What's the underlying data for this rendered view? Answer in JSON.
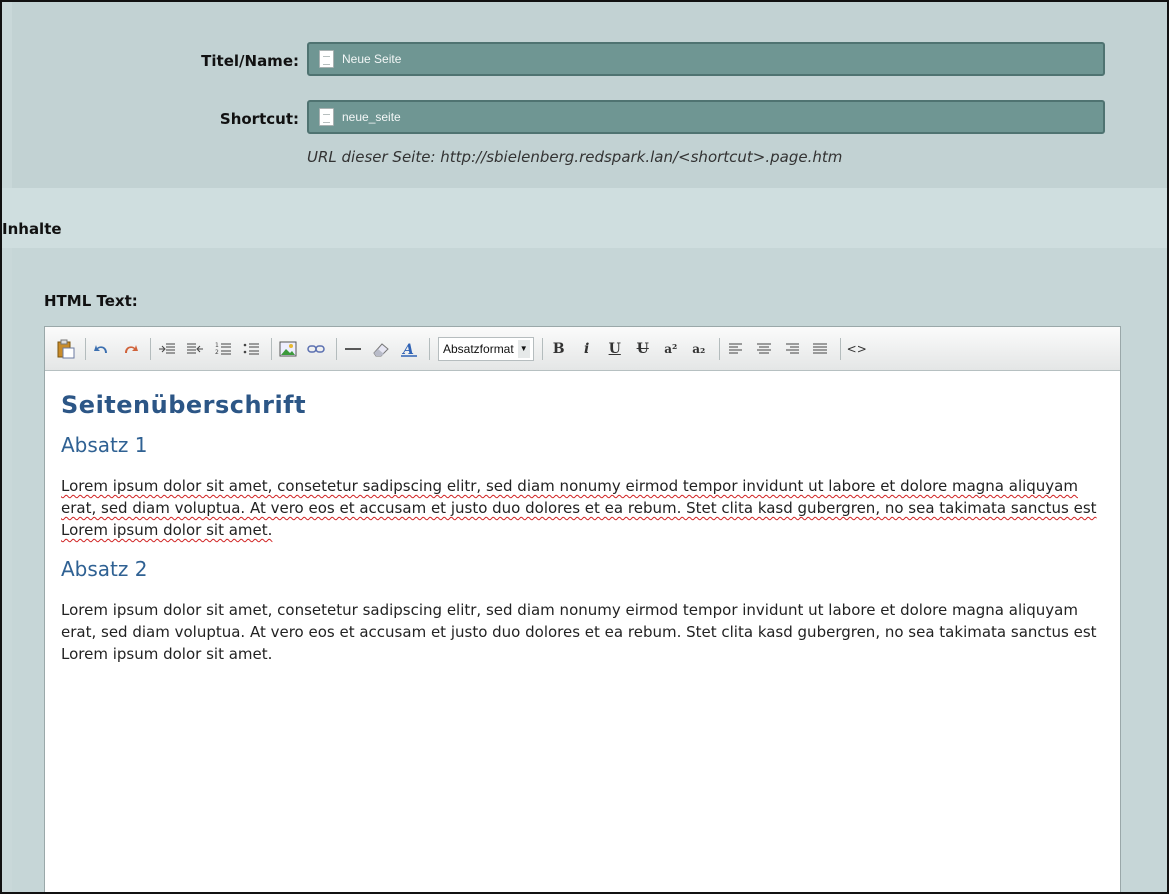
{
  "form": {
    "title_label": "Titel/Name:",
    "title_value": "Neue Seite",
    "shortcut_label": "Shortcut:",
    "shortcut_value": "neue_seite",
    "url_hint": "URL dieser Seite: http://sbielenberg.redspark.lan/<shortcut>.page.htm",
    "field_icon": "page-icon"
  },
  "section": {
    "title": "Inhalte"
  },
  "editor": {
    "label": "HTML Text:",
    "toolbar": {
      "format_select_value": "Absatzformat",
      "buttons": {
        "paste": "clipboard-icon",
        "undo": "undo-icon",
        "redo": "redo-icon",
        "indent": "indent-icon",
        "outdent": "outdent-icon",
        "ordered_list": "ordered-list-icon",
        "unordered_list": "unordered-list-icon",
        "image": "image-icon",
        "link": "link-icon",
        "horizontal_rule": "horizontal-rule-icon",
        "eraser": "eraser-icon",
        "text_style": "text-style-icon",
        "bold": "B",
        "italic": "i",
        "underline": "U",
        "strike": "U",
        "superscript": "a²",
        "subscript": "a₂",
        "align_left": "align-left-icon",
        "align_center": "align-center-icon",
        "align_right": "align-right-icon",
        "align_justify": "align-justify-icon",
        "source": "<>"
      }
    },
    "content": {
      "heading": "Seitenüberschrift",
      "paragraphs": [
        {
          "heading": "Absatz 1",
          "text": "Lorem ipsum dolor sit amet, consetetur sadipscing elitr, sed diam nonumy eirmod tempor invidunt ut labore et dolore magna aliquyam erat, sed diam voluptua. At vero eos et accusam et justo duo dolores et ea rebum. Stet clita kasd gubergren, no sea takimata sanctus est Lorem ipsum dolor sit amet."
        },
        {
          "heading": "Absatz 2",
          "text": "Lorem ipsum dolor sit amet, consetetur sadipscing elitr, sed diam nonumy eirmod tempor invidunt ut labore et dolore magna aliquyam erat, sed diam voluptua. At vero eos et accusam et justo duo dolores et ea rebum. Stet clita kasd gubergren, no sea takimata sanctus est Lorem ipsum dolor sit amet."
        }
      ]
    }
  }
}
